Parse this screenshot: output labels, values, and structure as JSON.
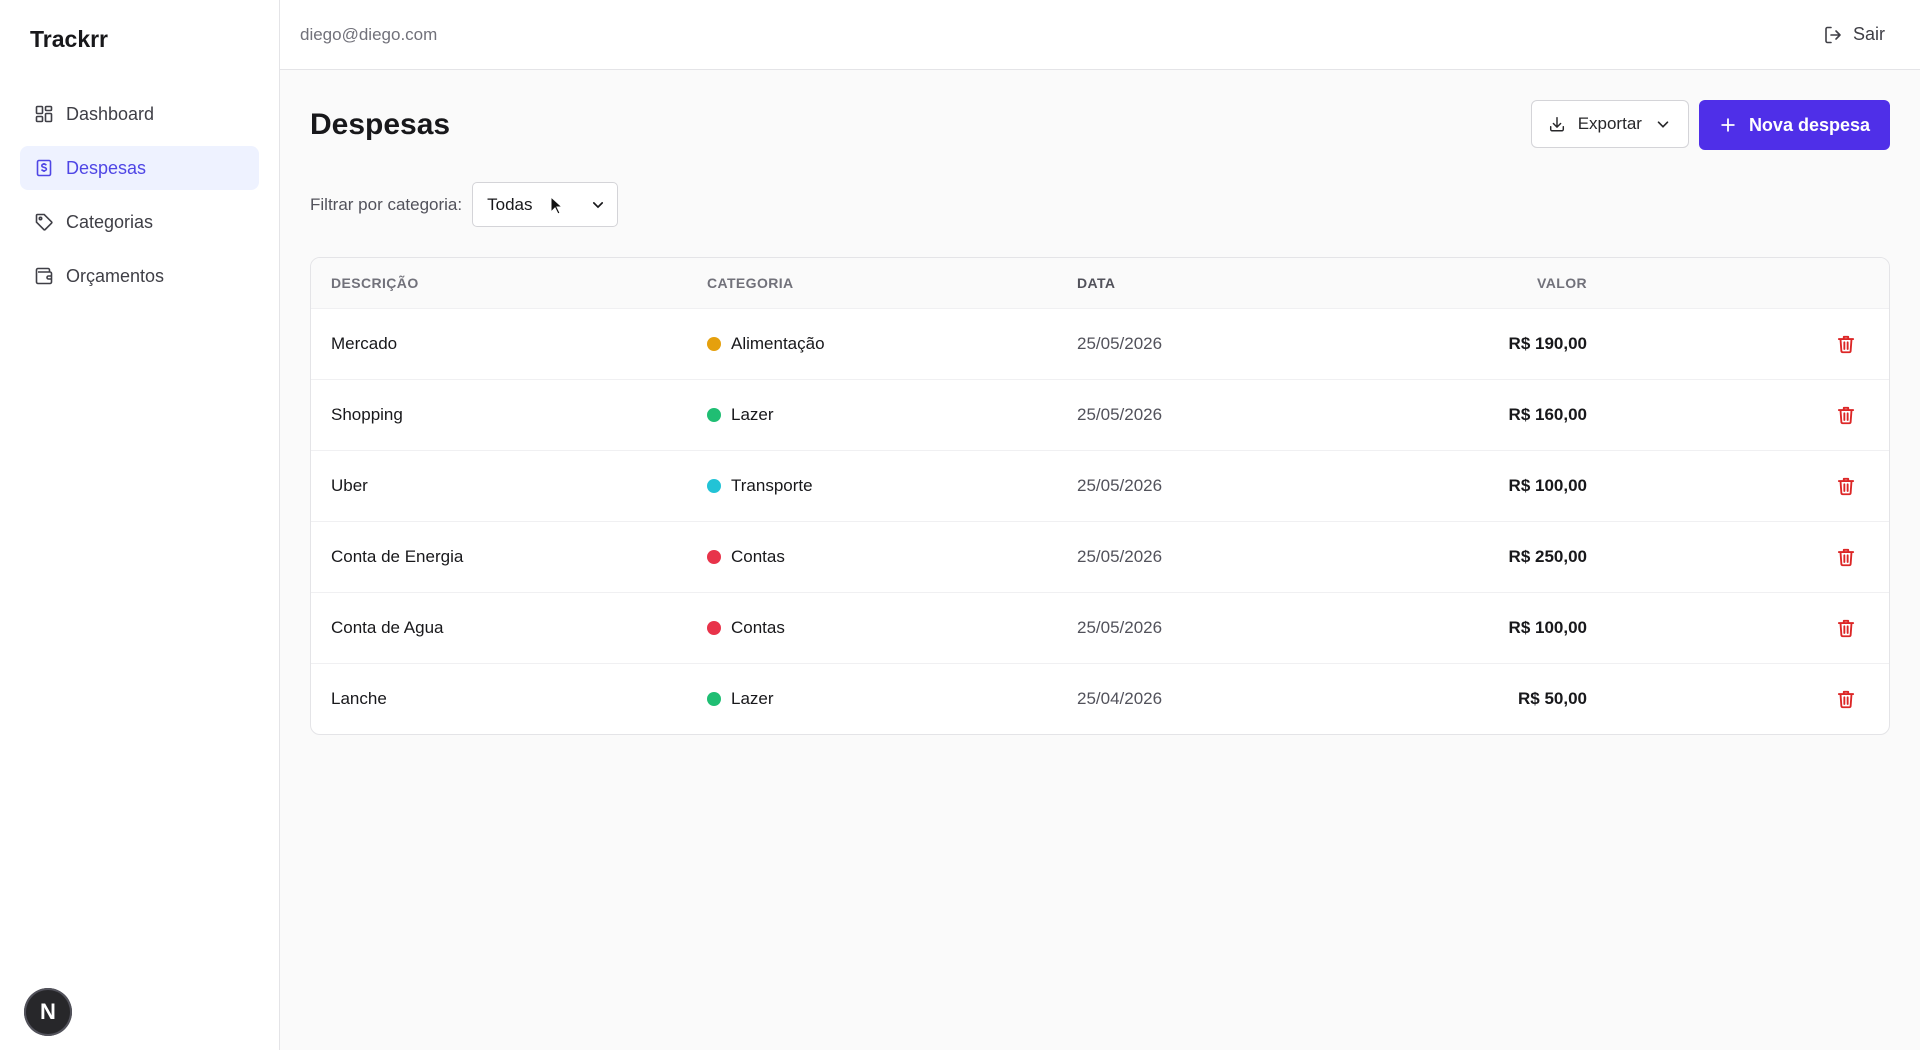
{
  "app": {
    "brand": "Trackrr"
  },
  "sidebar": {
    "items": [
      {
        "label": "Dashboard",
        "icon": "grid-icon",
        "active": false
      },
      {
        "label": "Despesas",
        "icon": "dollar-receipt-icon",
        "active": true
      },
      {
        "label": "Categorias",
        "icon": "tag-icon",
        "active": false
      },
      {
        "label": "Orçamentos",
        "icon": "wallet-icon",
        "active": false
      }
    ],
    "badge": "N"
  },
  "topbar": {
    "email": "diego@diego.com",
    "logout_label": "Sair"
  },
  "page": {
    "title": "Despesas",
    "export_label": "Exportar",
    "new_label": "Nova despesa",
    "filter_label": "Filtrar por categoria:",
    "filter_value": "Todas"
  },
  "table": {
    "headers": {
      "desc": "DESCRIÇÃO",
      "cat": "CATEGORIA",
      "date": "DATA",
      "value": "VALOR"
    },
    "rows": [
      {
        "desc": "Mercado",
        "cat": "Alimentação",
        "color": "#e5a00d",
        "date": "25/05/2026",
        "value": "R$ 190,00"
      },
      {
        "desc": "Shopping",
        "cat": "Lazer",
        "color": "#1fbe73",
        "date": "25/05/2026",
        "value": "R$ 160,00"
      },
      {
        "desc": "Uber",
        "cat": "Transporte",
        "color": "#22c3d6",
        "date": "25/05/2026",
        "value": "R$ 100,00"
      },
      {
        "desc": "Conta de Energia",
        "cat": "Contas",
        "color": "#e8334a",
        "date": "25/05/2026",
        "value": "R$ 250,00"
      },
      {
        "desc": "Conta de Agua",
        "cat": "Contas",
        "color": "#e8334a",
        "date": "25/05/2026",
        "value": "R$ 100,00"
      },
      {
        "desc": "Lanche",
        "cat": "Lazer",
        "color": "#1fbe73",
        "date": "25/04/2026",
        "value": "R$ 50,00"
      }
    ]
  },
  "colors": {
    "accent": "#4f2fe8",
    "active_bg": "#eef2ff",
    "active_text": "#4f46e5",
    "danger": "#dc2626"
  }
}
